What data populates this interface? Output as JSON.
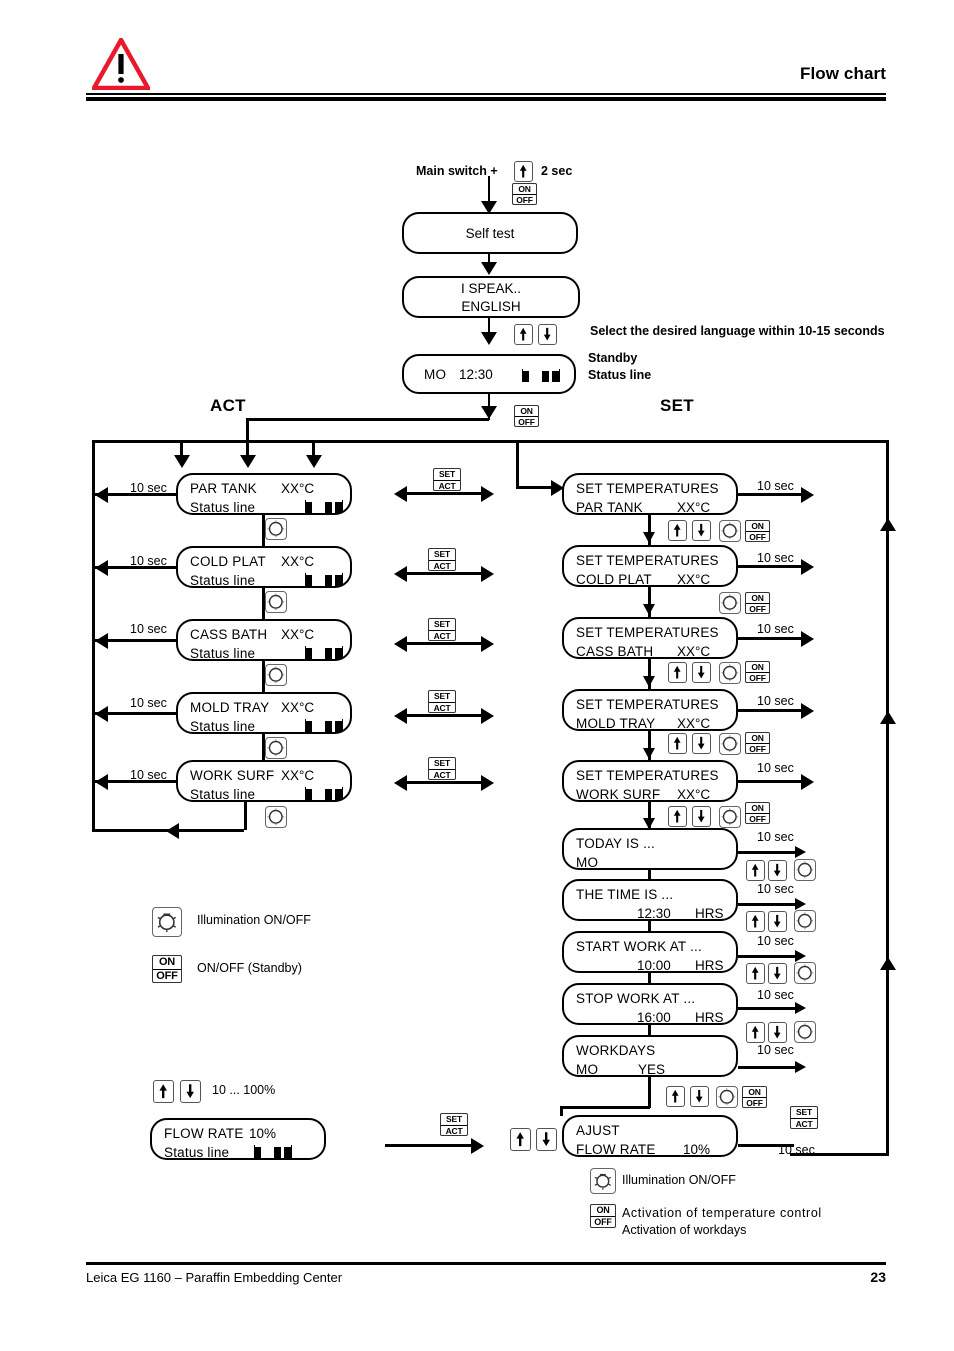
{
  "header": {
    "title": "Flow chart",
    "warning_icon": "warning-triangle-icon"
  },
  "footer": {
    "product": "Leica EG 1160 – Paraffin Embedding Center",
    "page": "23"
  },
  "start": {
    "main_switch_label": "Main switch  +",
    "duration_label": "2 sec",
    "up_key": "up-arrow-key-icon",
    "onoff_key": "on-off-key-icon"
  },
  "boot_boxes": [
    {
      "line1": "Self test"
    },
    {
      "line1": "I SPEAK..",
      "line2": "ENGLISH"
    }
  ],
  "standby_box": {
    "day": "MO",
    "time": "12:30",
    "statusbar": "status-bar-icon"
  },
  "notes": {
    "language": "Select the desired language within 10-15 seconds",
    "standby1": "Standby",
    "standby2": "Status line"
  },
  "columns": {
    "act_label": "ACT",
    "set_label": "SET"
  },
  "act_rows": [
    {
      "name": "PAR TANK",
      "temp": "XX°C",
      "status": "Status line",
      "timeout": "10 sec"
    },
    {
      "name": "COLD PLAT",
      "temp": "XX°C",
      "status": "Status line",
      "timeout": "10 sec"
    },
    {
      "name": "CASS BATH",
      "temp": "XX°C",
      "status": "Status line",
      "timeout": "10 sec"
    },
    {
      "name": "MOLD TRAY",
      "temp": "XX°C",
      "status": "Status line",
      "timeout": "10 sec"
    },
    {
      "name": "WORK SURF",
      "temp": "XX°C",
      "status": "Status line",
      "timeout": "10 sec"
    }
  ],
  "set_rows": [
    {
      "title": "SET TEMPERATURES",
      "name": "PAR TANK",
      "temp": "XX°C",
      "timeout": "10 sec"
    },
    {
      "title": "SET TEMPERATURES",
      "name": "COLD PLAT",
      "temp": "XX°C",
      "timeout": "10 sec"
    },
    {
      "title": "SET TEMPERATURES",
      "name": "CASS BATH",
      "temp": "XX°C",
      "timeout": "10 sec"
    },
    {
      "title": "SET TEMPERATURES",
      "name": "MOLD TRAY",
      "temp": "XX°C",
      "timeout": "10 sec"
    },
    {
      "title": "SET TEMPERATURES",
      "name": "WORK SURF",
      "temp": "XX°C",
      "timeout": "10 sec"
    }
  ],
  "schedule_rows": [
    {
      "line1": "TODAY IS ...",
      "value": "MO",
      "unit": "",
      "timeout": "10 sec"
    },
    {
      "line1": "THE TIME IS ...",
      "value": "12:30",
      "unit": "HRS",
      "timeout": "10 sec"
    },
    {
      "line1": "START WORK AT ...",
      "value": "10:00",
      "unit": "HRS",
      "timeout": "10 sec"
    },
    {
      "line1": "STOP WORK AT ...",
      "value": "16:00",
      "unit": "HRS",
      "timeout": "10 sec"
    },
    {
      "line1": "WORKDAYS",
      "value": "MO",
      "unit": "YES",
      "timeout": "10 sec"
    }
  ],
  "setact_label": {
    "set": "SET",
    "act": "ACT"
  },
  "legend_mid": [
    {
      "icon": "illumination-key-icon",
      "text": "Illumination ON/OFF"
    },
    {
      "icon": "on-off-key-icon",
      "text": "ON/OFF (Standby)"
    }
  ],
  "legend_range": {
    "text": "10 ... 100%"
  },
  "flow_rate_box": {
    "label": "FLOW RATE",
    "value": "10%",
    "status": "Status line"
  },
  "ajust_box": {
    "line1": "AJUST",
    "line2": "FLOW RATE",
    "value": "10%",
    "timeout": "10 sec"
  },
  "legend_bottom": [
    {
      "icon": "illumination-key-icon",
      "text": "Illumination ON/OFF"
    },
    {
      "icon": "on-off-key-icon",
      "text1": "Activation of temperature control",
      "text2": "Activation of workdays"
    }
  ],
  "colors": {
    "warning": "#E8192C",
    "ink": "#000000"
  }
}
